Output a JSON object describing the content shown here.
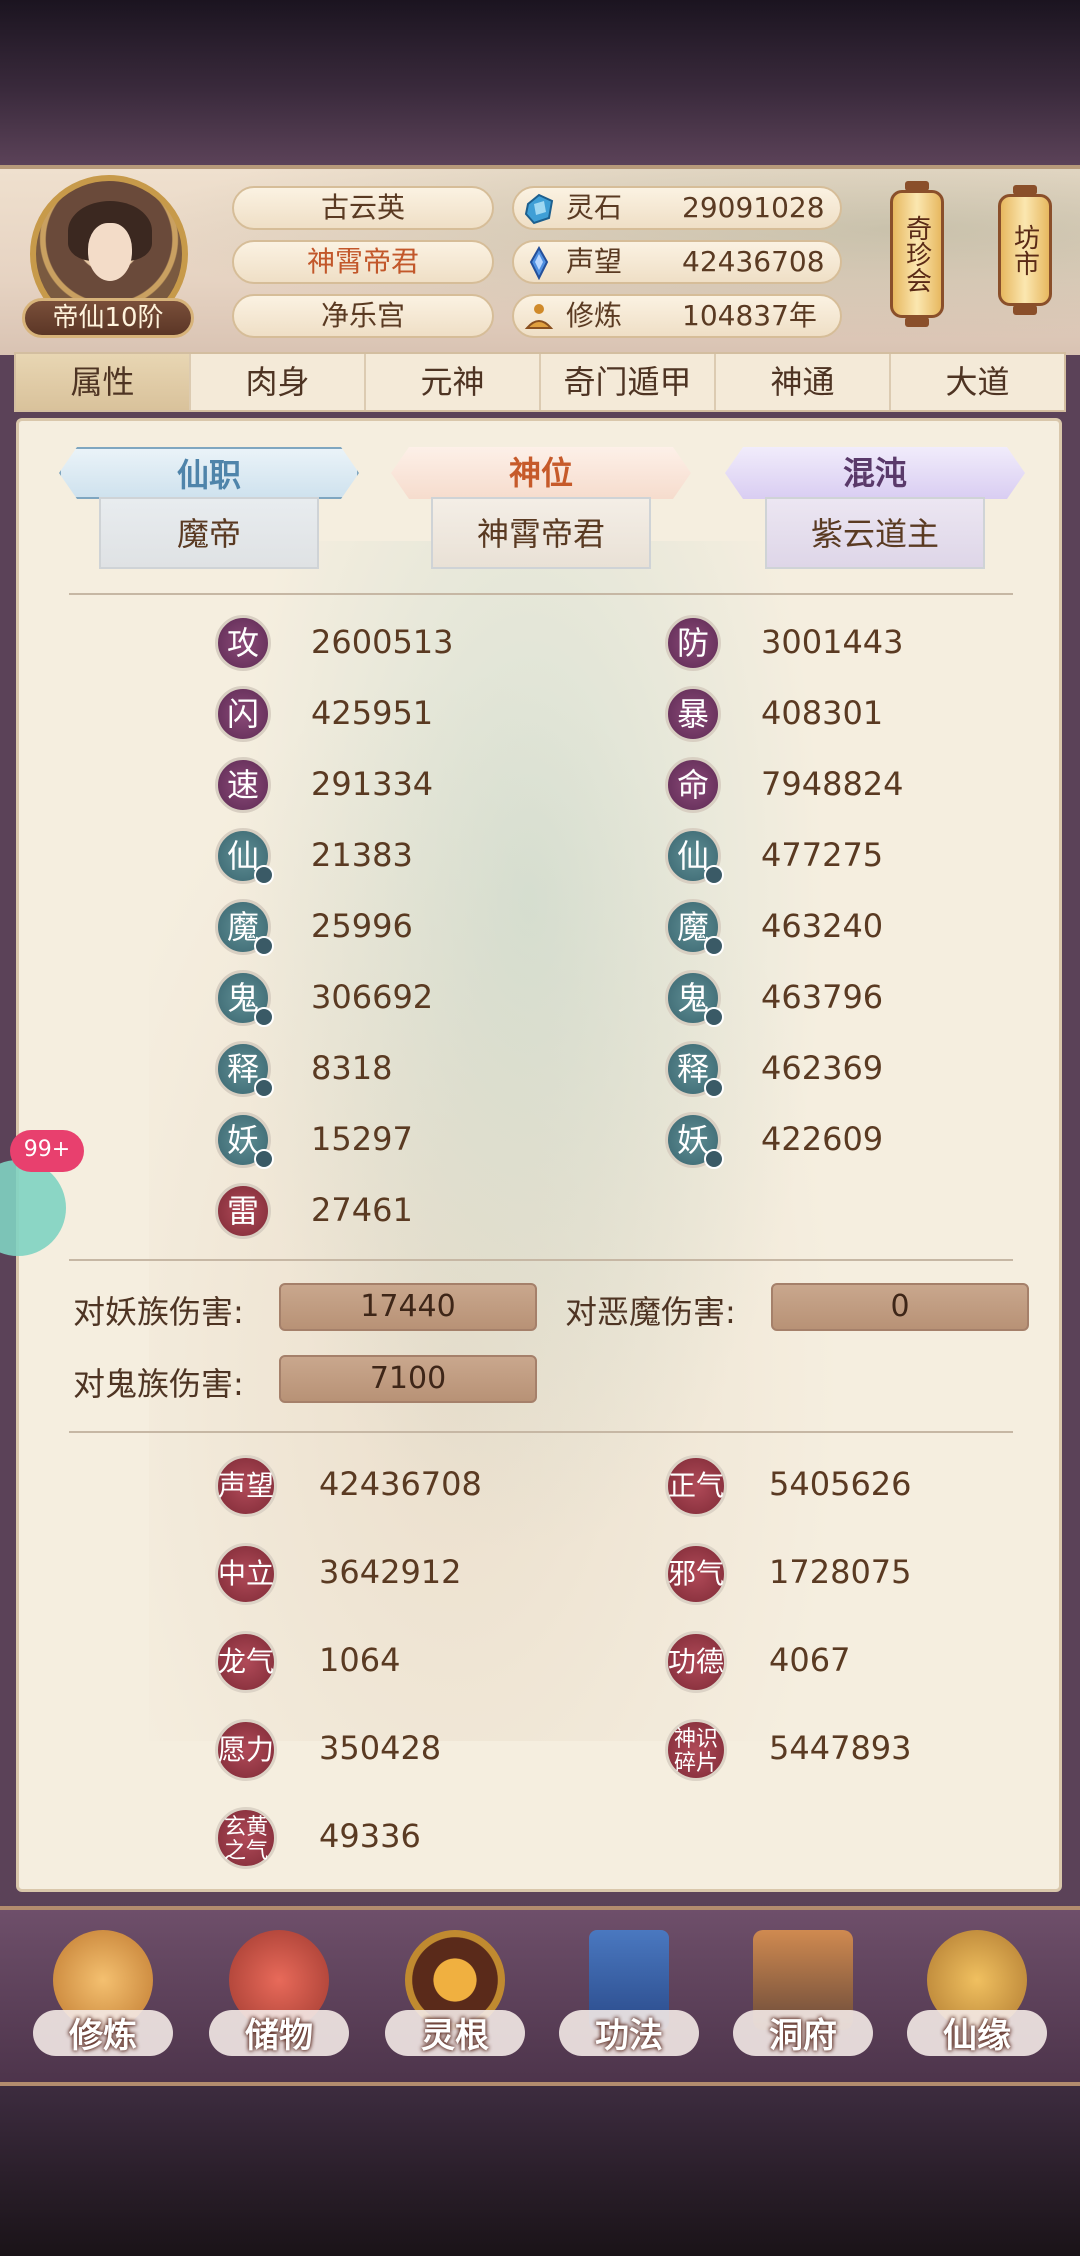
{
  "player": {
    "name": "古云英",
    "title": "神霄帝君",
    "sect": "净乐宫",
    "rank": "帝仙10阶"
  },
  "resources": [
    {
      "icon": "spirit-stone-icon",
      "label": "灵石",
      "value": "29091028"
    },
    {
      "icon": "reputation-crystal-icon",
      "label": "声望",
      "value": "42436708"
    },
    {
      "icon": "meditation-icon",
      "label": "修炼",
      "value": "104837年"
    }
  ],
  "side_buttons": {
    "treasure_fair": "奇珍会",
    "market": "坊市"
  },
  "tabs": [
    "属性",
    "肉身",
    "元神",
    "奇门遁甲",
    "神通",
    "大道"
  ],
  "active_tab": "属性",
  "titles": [
    {
      "label": "仙职",
      "value": "魔帝"
    },
    {
      "label": "神位",
      "value": "神霄帝君"
    },
    {
      "label": "混沌",
      "value": "紫云道主"
    }
  ],
  "stats_left": [
    {
      "char": "攻",
      "value": "2600513"
    },
    {
      "char": "闪",
      "value": "425951"
    },
    {
      "char": "速",
      "value": "291334"
    },
    {
      "char": "仙",
      "value": "21383"
    },
    {
      "char": "魔",
      "value": "25996"
    },
    {
      "char": "鬼",
      "value": "306692"
    },
    {
      "char": "释",
      "value": "8318"
    },
    {
      "char": "妖",
      "value": "15297"
    },
    {
      "char": "雷",
      "value": "27461"
    }
  ],
  "stats_right": [
    {
      "char": "防",
      "value": "3001443"
    },
    {
      "char": "暴",
      "value": "408301"
    },
    {
      "char": "命",
      "value": "7948824"
    },
    {
      "char": "仙",
      "value": "477275"
    },
    {
      "char": "魔",
      "value": "463240"
    },
    {
      "char": "鬼",
      "value": "463796"
    },
    {
      "char": "释",
      "value": "462369"
    },
    {
      "char": "妖",
      "value": "422609"
    }
  ],
  "damage": {
    "vs_demon_race_label": "对妖族伤害:",
    "vs_demon_race": "17440",
    "vs_evil_demon_label": "对恶魔伤害:",
    "vs_evil_demon": "0",
    "vs_ghost_race_label": "对鬼族伤害:",
    "vs_ghost_race": "7100"
  },
  "reputation_left": [
    {
      "label": "声望",
      "value": "42436708"
    },
    {
      "label": "中立",
      "value": "3642912"
    },
    {
      "label": "龙气",
      "value": "1064"
    },
    {
      "label": "愿力",
      "value": "350428"
    },
    {
      "label": "玄黄之气",
      "value": "49336"
    }
  ],
  "reputation_right": [
    {
      "label": "正气",
      "value": "5405626"
    },
    {
      "label": "邪气",
      "value": "1728075"
    },
    {
      "label": "功德",
      "value": "4067"
    },
    {
      "label": "神识碎片",
      "value": "5447893"
    }
  ],
  "notification_badge": "99+",
  "bottom_nav": [
    "修炼",
    "储物",
    "灵根",
    "功法",
    "洞府",
    "仙缘"
  ]
}
